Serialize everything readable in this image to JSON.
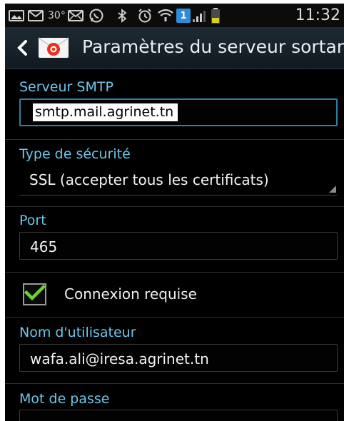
{
  "status_bar": {
    "time": "11:32",
    "temperature": "30°",
    "notification_badge": "1",
    "icons": [
      "image-icon",
      "email-icon",
      "email-icon",
      "whatsapp-icon",
      "bluetooth-icon",
      "alarm-icon",
      "wifi-icon",
      "sim-icon",
      "signal-icon",
      "battery-icon"
    ]
  },
  "action_bar": {
    "title": "Paramètres du serveur sortant"
  },
  "form": {
    "smtp": {
      "label": "Serveur SMTP",
      "value": "smtp.mail.agrinet.tn"
    },
    "security": {
      "label": "Type de sécurité",
      "value": "SSL (accepter tous les certificats)"
    },
    "port": {
      "label": "Port",
      "value": "465"
    },
    "auth": {
      "label": "Connexion requise",
      "checked": true
    },
    "username": {
      "label": "Nom d'utilisateur",
      "value": "wafa.ali@iresa.agrinet.tn"
    },
    "password": {
      "label": "Mot de passe",
      "value": ""
    }
  },
  "colors": {
    "label_blue": "#6dc6ea",
    "check_green": "#6dd437",
    "focus_border": "#2f7fa8",
    "background": "#000000"
  }
}
